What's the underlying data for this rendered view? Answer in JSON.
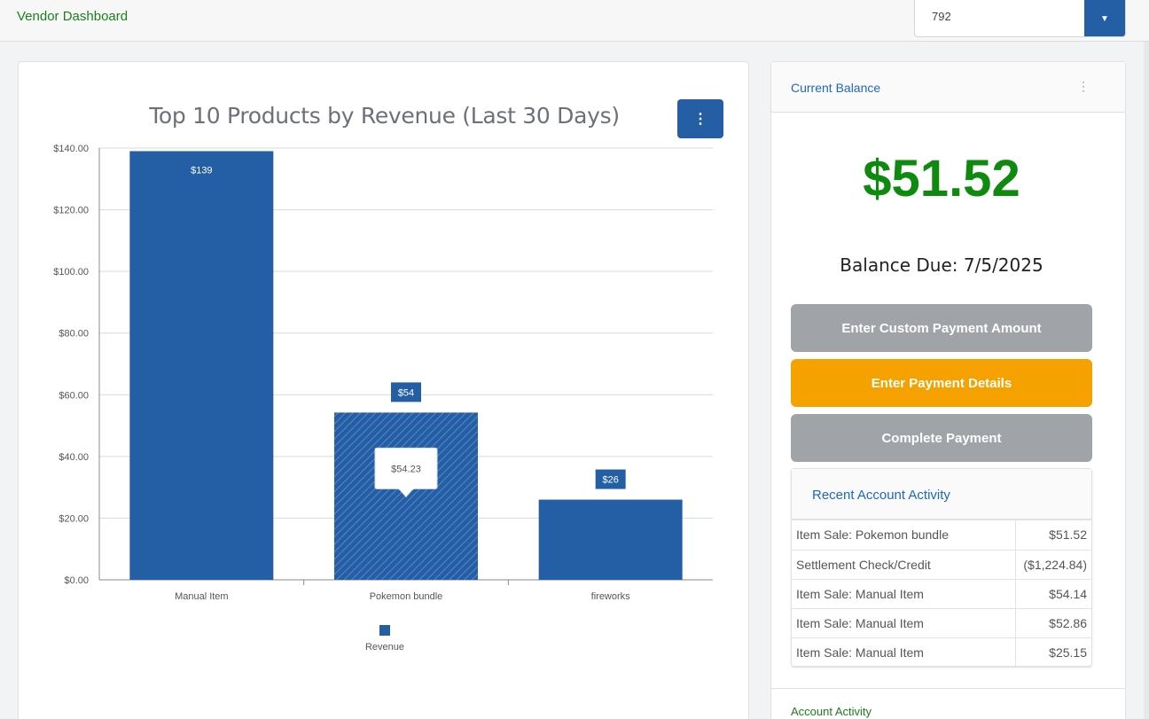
{
  "header": {
    "title": "Vendor Dashboard",
    "vendor_select_value": "792"
  },
  "chart_data": {
    "type": "bar",
    "title": "Top 10 Products by Revenue (Last 30 Days)",
    "categories": [
      "Manual Item",
      "Pokemon bundle",
      "fireworks"
    ],
    "series": [
      {
        "name": "Revenue",
        "values": [
          139,
          54.23,
          26
        ],
        "color": "#245fa5"
      }
    ],
    "data_labels": [
      "$139",
      "$54",
      "$26"
    ],
    "y_ticks": [
      "$0.00",
      "$20.00",
      "$40.00",
      "$60.00",
      "$80.00",
      "$100.00",
      "$120.00",
      "$140.00"
    ],
    "ylim": [
      0,
      140
    ],
    "grid": true,
    "legend": "bottom",
    "hovered_index": 1,
    "tooltip": "$54.23"
  },
  "balance": {
    "header_title": "Current Balance",
    "amount": "$51.52",
    "due": "Balance Due: 7/5/2025",
    "buttons": {
      "custom_amount": "Enter Custom Payment Amount",
      "payment_details": "Enter Payment Details",
      "complete": "Complete Payment"
    },
    "colors": {
      "amount": "#0e8a0e",
      "primary": "#245fa5",
      "warning": "#f5a100",
      "disabled": "#a0a3a8"
    }
  },
  "recent_activity": {
    "title": "Recent Account Activity",
    "rows": [
      {
        "desc": "Item Sale: Pokemon bundle",
        "amount": "$51.52"
      },
      {
        "desc": "Settlement Check/Credit",
        "amount": "($1,224.84)"
      },
      {
        "desc": "Item Sale: Manual Item",
        "amount": "$54.14"
      },
      {
        "desc": "Item Sale: Manual Item",
        "amount": "$52.86"
      },
      {
        "desc": "Item Sale: Manual Item",
        "amount": "$25.15"
      }
    ]
  },
  "account_activity": {
    "title": "Account Activity"
  },
  "icons": {
    "dropdown": "caret-down-icon",
    "menu": "kebab-menu-icon"
  }
}
